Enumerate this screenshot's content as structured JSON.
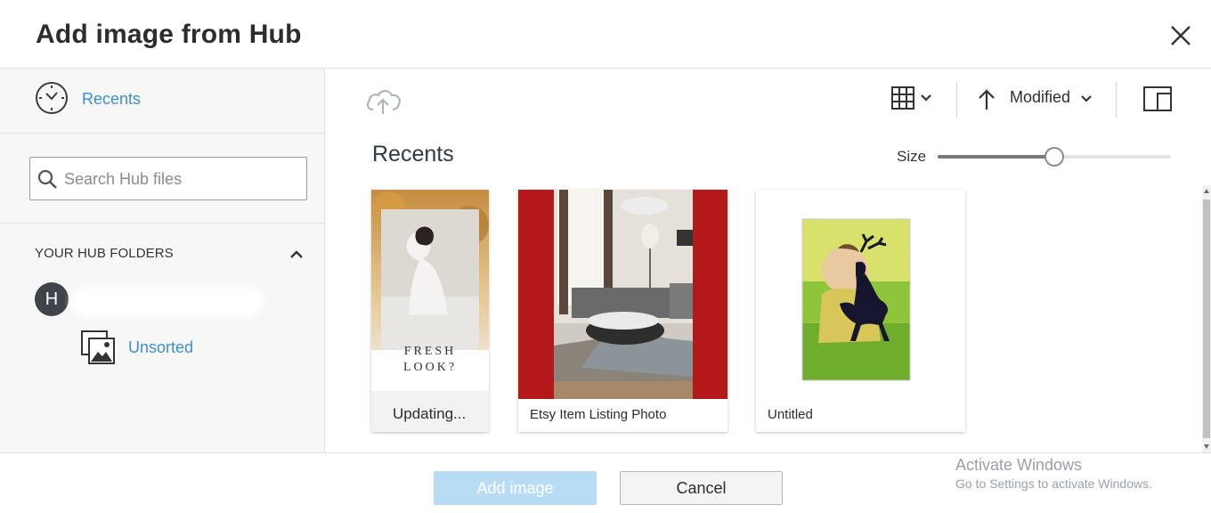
{
  "dialog": {
    "title": "Add image from Hub"
  },
  "sidebar": {
    "recents_label": "Recents",
    "search_placeholder": "Search Hub files",
    "folders_heading": "YOUR HUB FOLDERS",
    "user_initial": "H",
    "folder_label": "Unsorted"
  },
  "toolbar": {
    "sort_field": "Modified",
    "sort_direction": "ascending"
  },
  "main": {
    "section_title": "Recents",
    "size_label": "Size",
    "size_value_percent": 50
  },
  "cards": [
    {
      "name": "Updating...",
      "thumb_text_1": "FRESH",
      "thumb_text_2": "LOOK?"
    },
    {
      "name": "Etsy Item Listing Photo"
    },
    {
      "name": "Untitled"
    }
  ],
  "footer": {
    "add_label": "Add image",
    "cancel_label": "Cancel",
    "watermark_title": "Activate Windows",
    "watermark_sub": "Go to Settings to activate Windows."
  },
  "colors": {
    "link": "#3a8fd0",
    "add_button_disabled": "#b9dcf5",
    "listing_red": "#b3191a"
  }
}
